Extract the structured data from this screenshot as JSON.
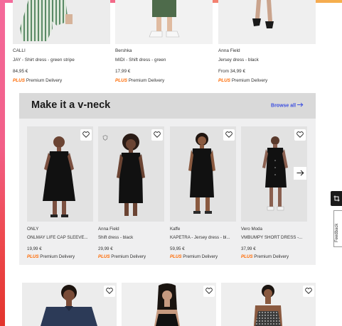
{
  "top_products": [
    {
      "brand": "CALLI",
      "name": "JAY - Shirt dress - green stripe",
      "price": "84,95 €",
      "plus": "PLUS",
      "delivery": "Premium Delivery"
    },
    {
      "brand": "Bershka",
      "name": "MIDI - Shift dress - green",
      "price": "17,99 €",
      "plus": "PLUS",
      "delivery": "Premium Delivery"
    },
    {
      "brand": "Anna Field",
      "name": "Jersey dress - black",
      "price": "From 34,99 €",
      "plus": "PLUS",
      "delivery": "Premium Delivery"
    }
  ],
  "carousel": {
    "title": "Make it a v-neck",
    "browse_label": "Browse all",
    "items": [
      {
        "brand": "ONLY",
        "name": "ONLMAY LIFE CAP SLEEVE...",
        "price": "19,99 €",
        "plus": "PLUS",
        "delivery": "Premium Delivery"
      },
      {
        "brand": "Anna Field",
        "name": "Shift dress - black",
        "price": "29,99 €",
        "plus": "PLUS",
        "delivery": "Premium Delivery"
      },
      {
        "brand": "Kaffe",
        "name": "KAPETRA - Jersey dress - bl...",
        "price": "59,95 €",
        "plus": "PLUS",
        "delivery": "Premium Delivery"
      },
      {
        "brand": "Vero Moda",
        "name": "VMBUMPY SHORT DRESS -...",
        "price": "37,99 €",
        "plus": "PLUS",
        "delivery": "Premium Delivery"
      }
    ]
  },
  "side": {
    "feedback_label": "Feedback"
  },
  "icons": {
    "wishlist": "heart-icon",
    "next": "arrow-right-icon",
    "browse": "arrow-right-icon",
    "sponsored": "badge-icon",
    "side_tab": "crop-icon"
  },
  "colors": {
    "plus": "#ff6900",
    "link": "#3c4fe0",
    "panel_bg": "#efeff0",
    "panel_header": "#d9d9d9"
  }
}
